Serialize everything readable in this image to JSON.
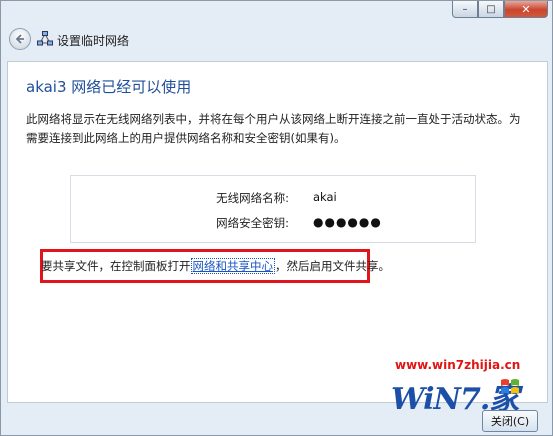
{
  "window": {
    "title": "设置临时网络",
    "caption": {
      "minimize": "–",
      "maximize": "□",
      "close": "✕"
    }
  },
  "icons": {
    "back": "back-arrow-icon",
    "network": "adhoc-network-icon"
  },
  "content": {
    "heading": "akai3 网络已经可以使用",
    "description": "此网络将显示在无线网络列表中，并将在每个用户从该网络上断开连接之前一直处于活动状态。为需要连接到此网络上的用户提供网络名称和安全密钥(如果有)。",
    "info": {
      "name_label": "无线网络名称:",
      "name_value": "akai",
      "key_label": "网络安全密钥:",
      "key_value": "●●●●●●"
    },
    "share": {
      "prefix": "要共享文件，在控制面板打开",
      "link": "网络和共享中心",
      "suffix": "，然后启用文件共享。"
    }
  },
  "watermark": {
    "url": "www.win7zhijia.cn",
    "logo": "WiN7.家"
  },
  "footer": {
    "close_label": "关闭(C)"
  },
  "colors": {
    "heading": "#1f4e9a",
    "link": "#1a54c4",
    "highlight": "#e2141b",
    "watermark_url": "#e01515",
    "watermark_logo": "#1b4fa8"
  }
}
